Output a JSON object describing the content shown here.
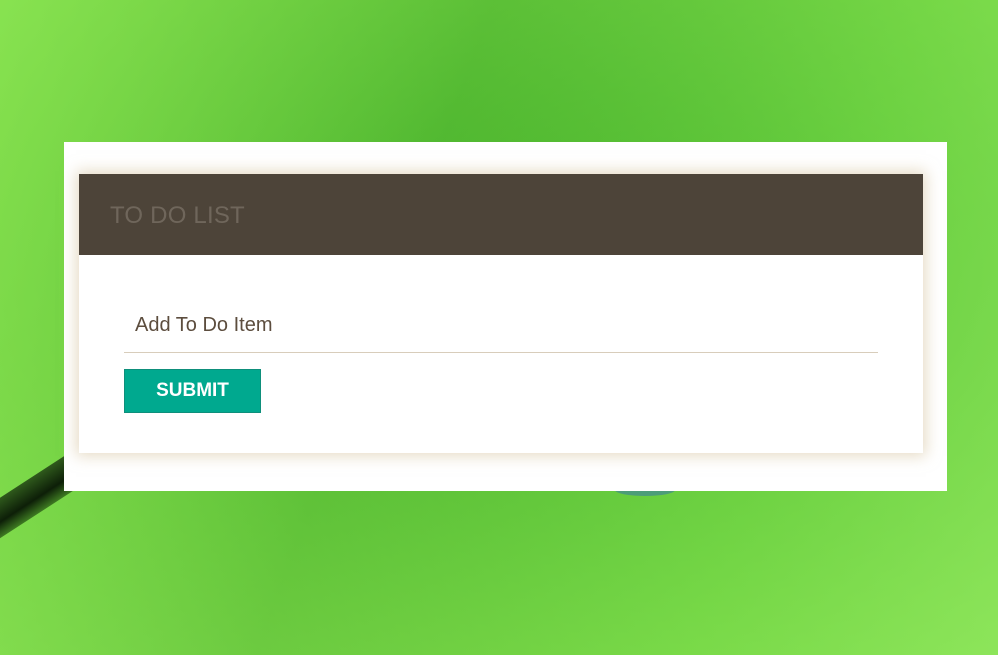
{
  "app": {
    "title": "TO DO LIST"
  },
  "form": {
    "input_placeholder": "Add To Do Item",
    "input_value": "",
    "submit_label": "SUBMIT"
  },
  "colors": {
    "header_bg": "#4d4439",
    "accent": "#00a98f",
    "background": "#5cc43a"
  }
}
